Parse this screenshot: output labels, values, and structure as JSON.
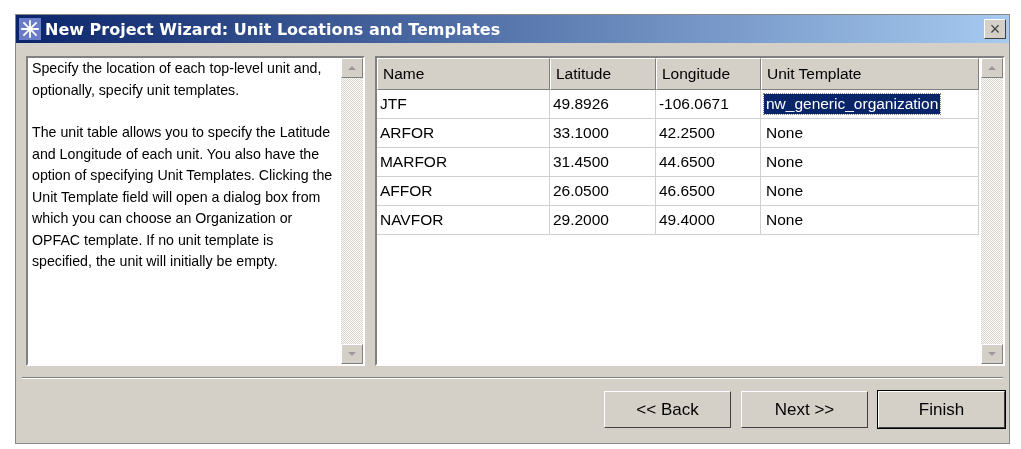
{
  "window": {
    "title": "New Project Wizard: Unit Locations and Templates",
    "close": "×"
  },
  "instructions": {
    "paragraphs": [
      "Specify the location of each top-level unit and, optionally, specify unit templates.",
      "The unit table allows you to specify the Latitude and Longitude of each unit.  You also have the option of specifying Unit Templates.  Clicking the Unit Template field will open a dialog box from which you can choose an Organization or OPFAC template.  If no unit template is specified, the unit will initially be empty."
    ]
  },
  "table": {
    "columns": [
      "Name",
      "Latitude",
      "Longitude",
      "Unit Template"
    ],
    "rows": [
      {
        "name": "JTF",
        "latitude": "49.8926",
        "longitude": "-106.0671",
        "unit_template": "nw_generic_organization",
        "selected": true
      },
      {
        "name": "ARFOR",
        "latitude": "33.1000",
        "longitude": "42.2500",
        "unit_template": "None",
        "selected": false
      },
      {
        "name": "MARFOR",
        "latitude": "31.4500",
        "longitude": "44.6500",
        "unit_template": "None",
        "selected": false
      },
      {
        "name": "AFFOR",
        "latitude": "26.0500",
        "longitude": "46.6500",
        "unit_template": "None",
        "selected": false
      },
      {
        "name": "NAVFOR",
        "latitude": "29.2000",
        "longitude": "49.4000",
        "unit_template": "None",
        "selected": false
      }
    ]
  },
  "buttons": [
    {
      "label": "<< Back",
      "kind": "normal"
    },
    {
      "label": "Next >>",
      "kind": "normal"
    },
    {
      "label": "Finish",
      "kind": "default"
    }
  ]
}
